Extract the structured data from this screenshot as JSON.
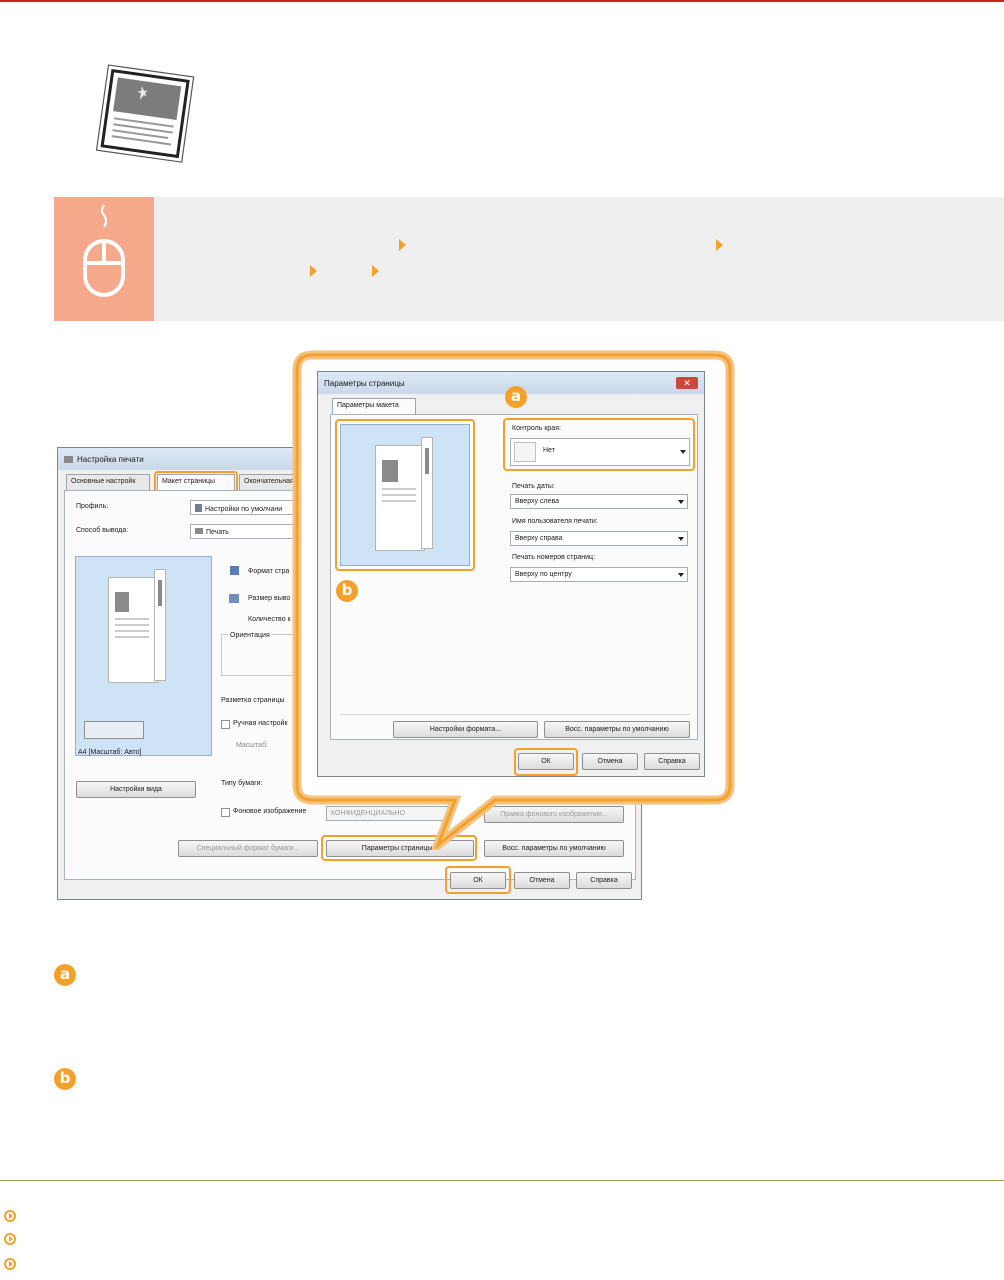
{
  "colors": {
    "accent": "#f3a12b",
    "top_rule": "#c9211e",
    "op_icon_bg": "#f5a98a",
    "preview_bg": "#cfe3f6"
  },
  "icons": {
    "illustration": "bordered-page-icon",
    "operation": "mouse-icon"
  },
  "main_dialog": {
    "title": "Настройка печати",
    "tabs": [
      "Основные настройк",
      "Макет страницы",
      "Окончательная"
    ],
    "profile_label": "Профиль:",
    "profile_value": "Настройки по умолчани",
    "output_label": "Способ вывода:",
    "output_value": "Печать",
    "page_size_label": "Формат стра",
    "output_size_label": "Размер выво",
    "copies_label": "Количество к",
    "orientation_label": "Ориентация",
    "preview_caption": "A4 [Масштаб: Авто]",
    "view_settings_button": "Настройки вида",
    "page_layout_label": "Разметка страницы",
    "manual_scaling_label": "Ручная настройк",
    "scale_label": "Масштаб:",
    "paper_type_label": "Типу бумаги:",
    "watermark_label": "Фоновое изображение",
    "watermark_value": "КОНФИДЕНЦИАЛЬНО",
    "watermark_edit_button": "Правка фонового изображения...",
    "custom_paper_button": "Специальный формат бумаги...",
    "page_options_button": "Параметры страницы...",
    "restore_defaults_button": "Восс. параметры по умолчанию",
    "ok_button": "ОК",
    "cancel_button": "Отмена",
    "help_button": "Справка"
  },
  "page_options_dialog": {
    "title": "Параметры страницы",
    "tab": "Параметры макета",
    "edge_control_label": "Контроль края:",
    "edge_control_value": "Нет",
    "print_date_label": "Печать даты:",
    "print_date_value": "Вверху слева",
    "print_user_label": "Имя пользователя печати:",
    "print_user_value": "Вверху справа",
    "page_numbers_label": "Печать номеров страниц:",
    "page_numbers_value": "Вверху по центру",
    "format_settings_button": "Настройки формата...",
    "restore_defaults_button": "Восс. параметры по умолчанию",
    "ok_button": "ОК",
    "cancel_button": "Отмена",
    "help_button": "Справка"
  },
  "callouts": {
    "a": "a",
    "b": "b"
  }
}
